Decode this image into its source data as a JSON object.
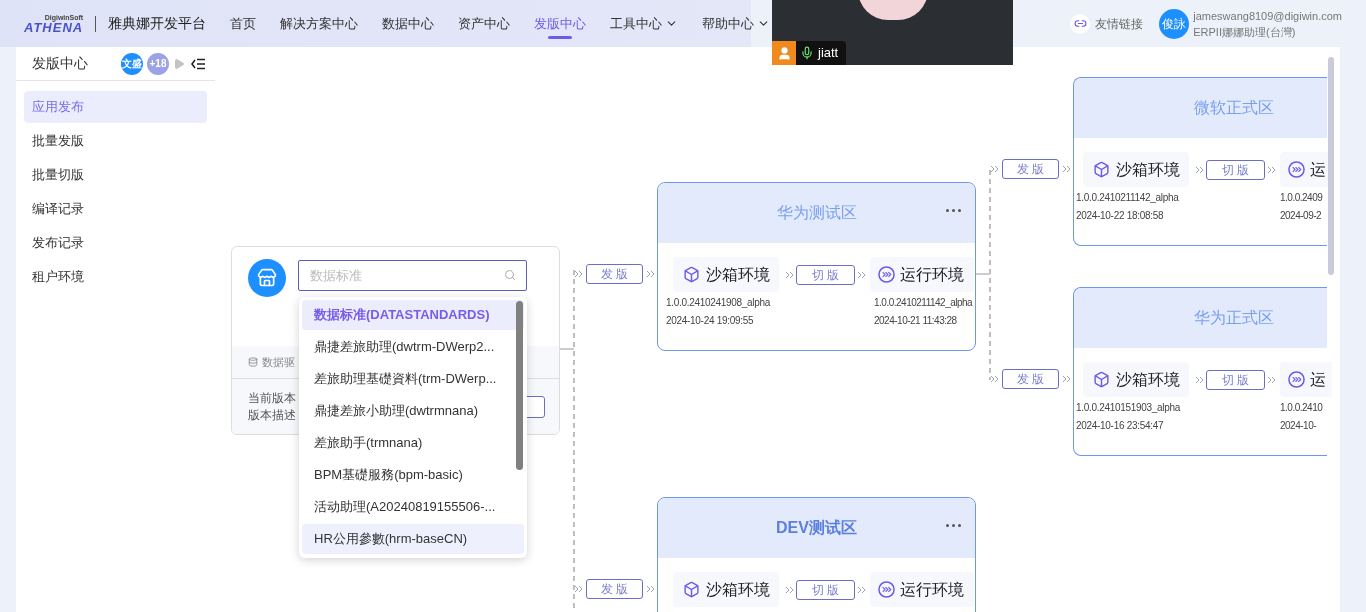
{
  "header": {
    "logo": {
      "small": "DigiwinSoft",
      "brand": "ATHENA"
    },
    "platform_title": "雅典娜开发平台",
    "nav": [
      {
        "label": "首页",
        "selected": false,
        "has_menu": false
      },
      {
        "label": "解决方案中心",
        "selected": false,
        "has_menu": false
      },
      {
        "label": "数据中心",
        "selected": false,
        "has_menu": false
      },
      {
        "label": "资产中心",
        "selected": false,
        "has_menu": false
      },
      {
        "label": "发版中心",
        "selected": true,
        "has_menu": false
      },
      {
        "label": "工具中心",
        "selected": false,
        "has_menu": true
      },
      {
        "label": "帮助中心",
        "selected": false,
        "has_menu": true
      }
    ],
    "friend_link": "友情链接",
    "user": {
      "avatar_text": "俊詠",
      "email": "jameswang8109@digiwin.com",
      "role": "ERPII娜娜助理(台灣)"
    }
  },
  "video_overlay": {
    "name": "jiatt"
  },
  "sidebar": {
    "title": "发版中心",
    "collaborators": [
      {
        "text": "文盛",
        "kind": "avatar"
      },
      {
        "text": "+18",
        "kind": "count"
      }
    ],
    "items": [
      {
        "label": "应用发布",
        "selected": true
      },
      {
        "label": "批量发版",
        "selected": false
      },
      {
        "label": "批量切版",
        "selected": false
      },
      {
        "label": "编译记录",
        "selected": false
      },
      {
        "label": "发布记录",
        "selected": false
      },
      {
        "label": "租户环境",
        "selected": false
      }
    ]
  },
  "source_card": {
    "search_placeholder": "数据标准",
    "data_source_label": "数据驱",
    "current_version_label": "当前版本",
    "description_label": "版本描述"
  },
  "dropdown": [
    {
      "label": "数据标准(DATASTANDARDS)",
      "selected": true,
      "highlighted": false
    },
    {
      "label": "鼎捷差旅助理(dwtrm-DWerp2...",
      "selected": false,
      "highlighted": false
    },
    {
      "label": "差旅助理基礎資料(trm-DWerp...",
      "selected": false,
      "highlighted": false
    },
    {
      "label": "鼎捷差旅小助理(dwtrmnana)",
      "selected": false,
      "highlighted": false
    },
    {
      "label": "差旅助手(trmnana)",
      "selected": false,
      "highlighted": false
    },
    {
      "label": "BPM基礎服務(bpm-basic)",
      "selected": false,
      "highlighted": false
    },
    {
      "label": "活动助理(A20240819155506-...",
      "selected": false,
      "highlighted": false
    },
    {
      "label": "HR公用參數(hrm-baseCN)",
      "selected": false,
      "highlighted": true
    }
  ],
  "nodes": [
    {
      "title": "华为测试区",
      "emphasized": false,
      "has_menu": true,
      "publish_label": "发 版",
      "switch_label": "切 版",
      "sandbox": {
        "label": "沙箱环境",
        "version": "1.0.0.2410241908_alpha",
        "time": "2024-10-24 19:09:55"
      },
      "runtime": {
        "label": "运行环境",
        "version": "1.0.0.2410211142_alpha",
        "time": "2024-10-21 11:43:28"
      }
    },
    {
      "title": "DEV测试区",
      "emphasized": true,
      "has_menu": true,
      "publish_label": "发 版",
      "switch_label": "切 版",
      "sandbox": {
        "label": "沙箱环境"
      },
      "runtime": {
        "label": "运行环境"
      }
    },
    {
      "title": "微软正式区",
      "emphasized": false,
      "has_menu": false,
      "publish_label": "发 版",
      "switch_label": "切 版",
      "sandbox": {
        "label": "沙箱环境",
        "version": "1.0.0.2410211142_alpha",
        "time": "2024-10-22 18:08:58"
      },
      "runtime": {
        "label": "运",
        "version": "1.0.0.2409",
        "time": "2024-09-2"
      }
    },
    {
      "title": "华为正式区",
      "emphasized": false,
      "has_menu": false,
      "publish_label": "发 版",
      "switch_label": "切 版",
      "sandbox": {
        "label": "沙箱环境",
        "version": "1.0.0.2410151903_alpha",
        "time": "2024-10-16 23:54:47"
      },
      "runtime": {
        "label": "运",
        "version": "1.0.0.2410",
        "time": "2024-10-"
      }
    }
  ]
}
